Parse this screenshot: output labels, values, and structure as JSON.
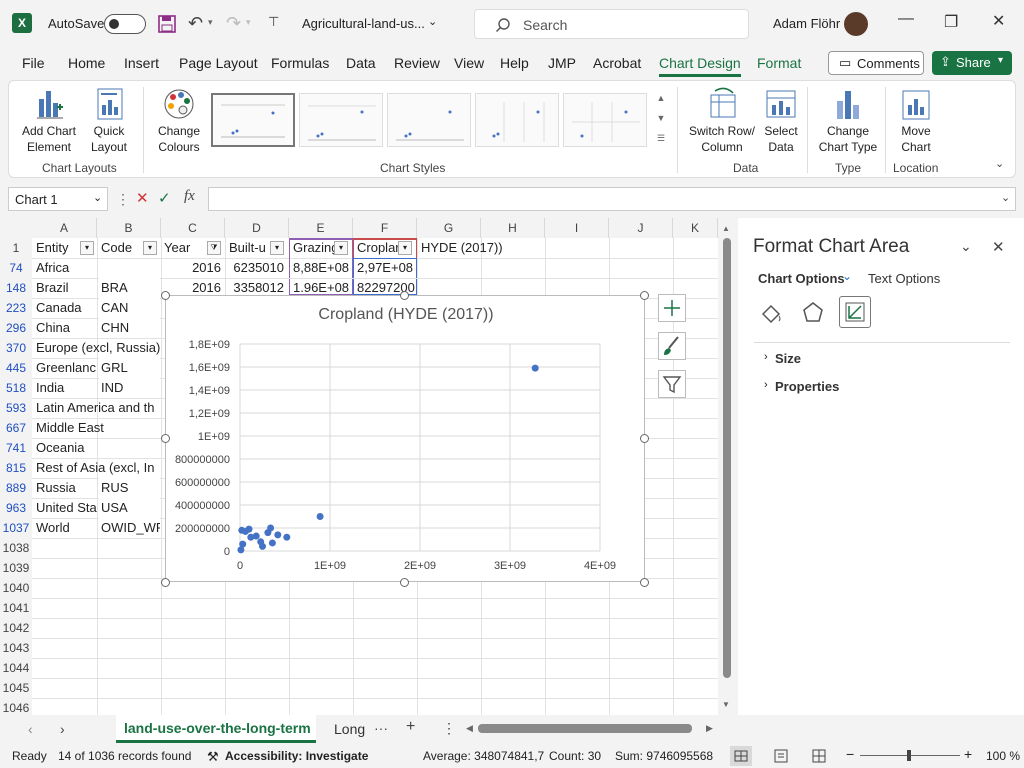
{
  "titlebar": {
    "autosave_label": "AutoSave",
    "file_name": "Agricultural-land-us...",
    "search_placeholder": "Search",
    "user_name": "Adam Flöhr"
  },
  "menu": {
    "items": [
      "File",
      "Home",
      "Insert",
      "Page Layout",
      "Formulas",
      "Data",
      "Review",
      "View",
      "Help",
      "JMP",
      "Acrobat",
      "Chart Design",
      "Format"
    ],
    "active": "Chart Design",
    "comments_label": "Comments",
    "share_label": "Share"
  },
  "ribbon": {
    "add_chart_element": [
      "Add Chart",
      "Element"
    ],
    "quick_layout": [
      "Quick",
      "Layout"
    ],
    "change_colours": [
      "Change",
      "Colours"
    ],
    "switch_row_column": [
      "Switch Row/",
      "Column"
    ],
    "select_data": [
      "Select",
      "Data"
    ],
    "change_chart_type": [
      "Change",
      "Chart Type"
    ],
    "move_chart": [
      "Move",
      "Chart"
    ],
    "groups": {
      "chart_layouts": "Chart Layouts",
      "chart_styles": "Chart Styles",
      "data": "Data",
      "type": "Type",
      "location": "Location"
    }
  },
  "formula_bar": {
    "name_box": "Chart 1",
    "fx_label": "fx"
  },
  "sheet": {
    "columns": [
      "A",
      "B",
      "C",
      "D",
      "E",
      "F",
      "G",
      "H",
      "I",
      "J",
      "K"
    ],
    "header_row": {
      "row_num": "1",
      "cells": [
        "Entity",
        "Code",
        "Year",
        "Built-u",
        "Grazing",
        "Croplar",
        "HYDE (2017))"
      ]
    },
    "rows": [
      {
        "num": "74",
        "entity": "Africa",
        "code": "",
        "year": "2016",
        "built": "6235010",
        "grazing": "8,88E+08",
        "crop": "2,97E+08"
      },
      {
        "num": "148",
        "entity": "Brazil",
        "code": "BRA",
        "year": "2016",
        "built": "3358012",
        "grazing": "1.96E+08",
        "crop": "82297200"
      },
      {
        "num": "223",
        "entity": "Canada",
        "code": "CAN",
        "year": "",
        "built": "",
        "grazing": "",
        "crop": ""
      },
      {
        "num": "296",
        "entity": "China",
        "code": "CHN",
        "year": "",
        "built": "",
        "grazing": "",
        "crop": ""
      },
      {
        "num": "370",
        "entity": "Europe (excl, Russia)",
        "code": "",
        "year": "",
        "built": "",
        "grazing": "",
        "crop": ""
      },
      {
        "num": "445",
        "entity": "Greenlanc",
        "code": "GRL",
        "year": "",
        "built": "",
        "grazing": "",
        "crop": ""
      },
      {
        "num": "518",
        "entity": "India",
        "code": "IND",
        "year": "",
        "built": "",
        "grazing": "",
        "crop": ""
      },
      {
        "num": "593",
        "entity": "Latin America and th",
        "code": "",
        "year": "",
        "built": "",
        "grazing": "",
        "crop": ""
      },
      {
        "num": "667",
        "entity": "Middle East",
        "code": "",
        "year": "",
        "built": "",
        "grazing": "",
        "crop": ""
      },
      {
        "num": "741",
        "entity": "Oceania",
        "code": "",
        "year": "",
        "built": "",
        "grazing": "",
        "crop": ""
      },
      {
        "num": "815",
        "entity": "Rest of Asia (excl, In",
        "code": "",
        "year": "",
        "built": "",
        "grazing": "",
        "crop": ""
      },
      {
        "num": "889",
        "entity": "Russia",
        "code": "RUS",
        "year": "",
        "built": "",
        "grazing": "",
        "crop": ""
      },
      {
        "num": "963",
        "entity": "United Sta",
        "code": "USA",
        "year": "",
        "built": "",
        "grazing": "",
        "crop": ""
      },
      {
        "num": "1037",
        "entity": "World",
        "code": "OWID_WF",
        "year": "",
        "built": "",
        "grazing": "",
        "crop": ""
      }
    ],
    "empty_rows": [
      "1038",
      "1039",
      "1040",
      "1041",
      "1042",
      "1043",
      "1044",
      "1045",
      "1046"
    ]
  },
  "chart_data": {
    "type": "scatter",
    "title": "Cropland (HYDE (2017))",
    "xlim": [
      0,
      4000000000
    ],
    "ylim": [
      0,
      1800000000
    ],
    "x_ticks": [
      "0",
      "1E+09",
      "2E+09",
      "3E+09",
      "4E+09"
    ],
    "y_ticks": [
      "0",
      "200000000",
      "400000000",
      "600000000",
      "800000000",
      "1E+09",
      "1,2E+09",
      "1,4E+09",
      "1,6E+09",
      "1,8E+09"
    ],
    "grid": true,
    "marker_color": "#4472c4",
    "points": [
      [
        3280000000,
        1590000000
      ],
      [
        890000000,
        300000000
      ],
      [
        520000000,
        120000000
      ],
      [
        420000000,
        140000000
      ],
      [
        340000000,
        200000000
      ],
      [
        310000000,
        160000000
      ],
      [
        360000000,
        70000000
      ],
      [
        230000000,
        80000000
      ],
      [
        250000000,
        40000000
      ],
      [
        180000000,
        130000000
      ],
      [
        100000000,
        190000000
      ],
      [
        120000000,
        120000000
      ],
      [
        20000000,
        180000000
      ],
      [
        30000000,
        60000000
      ],
      [
        10000000,
        10000000
      ],
      [
        60000000,
        170000000
      ]
    ]
  },
  "format_pane": {
    "title": "Format Chart Area",
    "tab_chart_options": "Chart Options",
    "tab_text_options": "Text Options",
    "sections": [
      "Size",
      "Properties"
    ]
  },
  "sheet_tabs": {
    "active": "land-use-over-the-long-term",
    "other": "Long"
  },
  "status": {
    "ready": "Ready",
    "records": "14 of 1036 records found",
    "accessibility": "Accessibility: Investigate",
    "average": "Average: 348074841,7",
    "count": "Count: 30",
    "sum": "Sum: 9746095568",
    "zoom": "100 %"
  }
}
